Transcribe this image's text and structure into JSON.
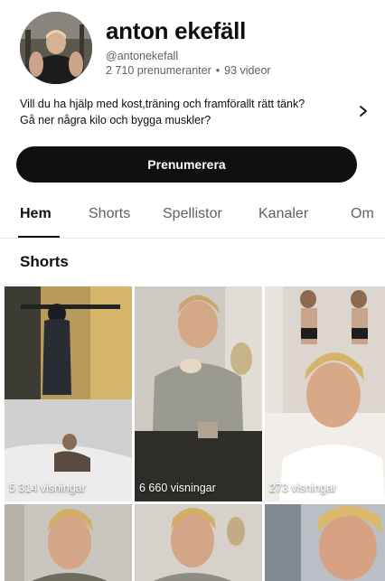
{
  "channel": {
    "name": "anton ekefäll",
    "handle": "@antonekefall",
    "subscribers": "2 710 prenumeranter",
    "separator": "•",
    "videos": "93 videor",
    "description_line1": "Vill du ha hjälp med kost,träning och framförallt rätt tänk?",
    "description_line2": "Gå ner några kilo och bygga muskler?",
    "description_arrow_icon": "chevron-right-icon"
  },
  "subscribe": {
    "label": "Prenumerera"
  },
  "tabs": [
    {
      "label": "Hem",
      "active": true
    },
    {
      "label": "Shorts",
      "active": false
    },
    {
      "label": "Spellistor",
      "active": false
    },
    {
      "label": "Kanaler",
      "active": false
    },
    {
      "label": "Om",
      "active": false
    }
  ],
  "section": {
    "title": "Shorts"
  },
  "shorts": [
    {
      "views": "5 314 visningar"
    },
    {
      "views": "6 660 visningar"
    },
    {
      "views": "273 visningar"
    },
    {
      "views": ""
    },
    {
      "views": ""
    },
    {
      "views": ""
    }
  ],
  "colors": {
    "primary_text": "#0f0f0f",
    "secondary_text": "#606060",
    "button_bg": "#0f0f0f",
    "button_text": "#ffffff"
  }
}
